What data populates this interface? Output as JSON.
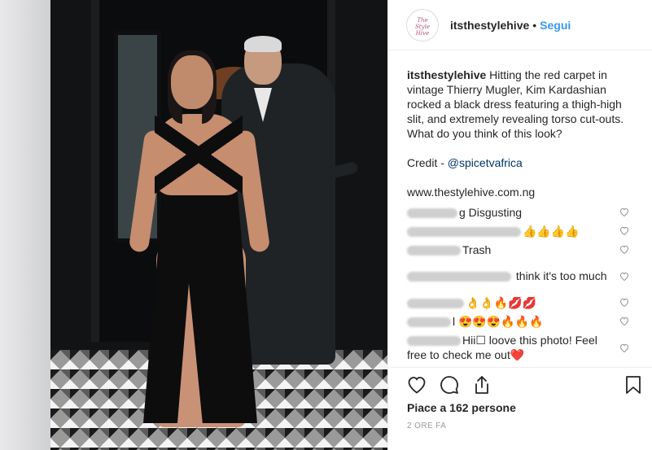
{
  "post": {
    "username": "itsthestylehive",
    "separator": "•",
    "follow_label": "Segui",
    "avatar_text": "The Style Hive",
    "caption": {
      "username": "itsthestylehive",
      "text": "Hitting the red carpet in vintage Thierry Mugler, Kim Kardashian rocked a black dress featuring a thigh-high slit, and extremely revealing torso cut-outs. What do you think of this look?",
      "credit_prefix": "Credit - ",
      "credit_handle": "@spicetvafrica",
      "website": "www.thestylehive.com.ng"
    },
    "comments": [
      {
        "text": "g Disgusting"
      },
      {
        "text": "👍👍👍👍"
      },
      {
        "text": "Trash"
      },
      {
        "text": " think it's too much"
      },
      {
        "text": "👌👌🔥💋💋"
      },
      {
        "text": "l 😍😍😍🔥🔥🔥"
      },
      {
        "text": "Hii☐ loove this photo! Feel free to check me out❤️"
      }
    ],
    "likes_text": "Piace a 162 persone",
    "time_ago": "2 ORE FA"
  },
  "icons": {
    "like": "heart-icon",
    "comment": "comment-icon",
    "share": "share-icon",
    "save": "bookmark-icon"
  }
}
